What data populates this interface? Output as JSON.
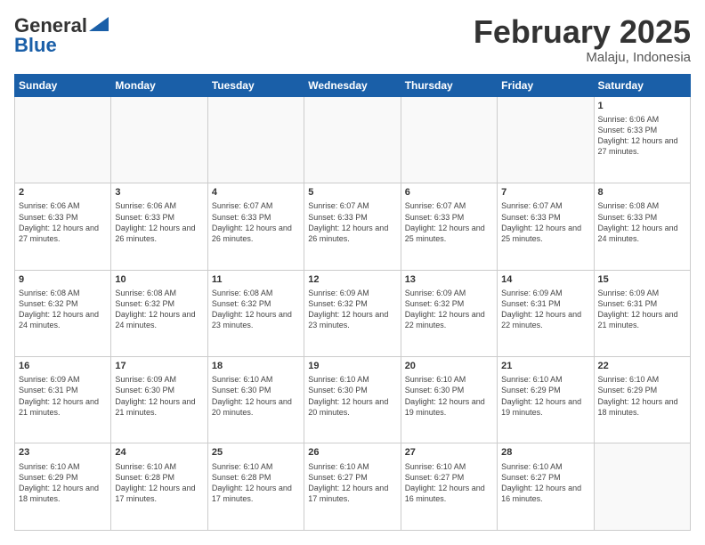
{
  "logo": {
    "line1": "General",
    "line2": "Blue"
  },
  "title": "February 2025",
  "location": "Malaju, Indonesia",
  "days_of_week": [
    "Sunday",
    "Monday",
    "Tuesday",
    "Wednesday",
    "Thursday",
    "Friday",
    "Saturday"
  ],
  "weeks": [
    [
      {
        "day": "",
        "info": ""
      },
      {
        "day": "",
        "info": ""
      },
      {
        "day": "",
        "info": ""
      },
      {
        "day": "",
        "info": ""
      },
      {
        "day": "",
        "info": ""
      },
      {
        "day": "",
        "info": ""
      },
      {
        "day": "1",
        "info": "Sunrise: 6:06 AM\nSunset: 6:33 PM\nDaylight: 12 hours and 27 minutes."
      }
    ],
    [
      {
        "day": "2",
        "info": "Sunrise: 6:06 AM\nSunset: 6:33 PM\nDaylight: 12 hours and 27 minutes."
      },
      {
        "day": "3",
        "info": "Sunrise: 6:06 AM\nSunset: 6:33 PM\nDaylight: 12 hours and 26 minutes."
      },
      {
        "day": "4",
        "info": "Sunrise: 6:07 AM\nSunset: 6:33 PM\nDaylight: 12 hours and 26 minutes."
      },
      {
        "day": "5",
        "info": "Sunrise: 6:07 AM\nSunset: 6:33 PM\nDaylight: 12 hours and 26 minutes."
      },
      {
        "day": "6",
        "info": "Sunrise: 6:07 AM\nSunset: 6:33 PM\nDaylight: 12 hours and 25 minutes."
      },
      {
        "day": "7",
        "info": "Sunrise: 6:07 AM\nSunset: 6:33 PM\nDaylight: 12 hours and 25 minutes."
      },
      {
        "day": "8",
        "info": "Sunrise: 6:08 AM\nSunset: 6:33 PM\nDaylight: 12 hours and 24 minutes."
      }
    ],
    [
      {
        "day": "9",
        "info": "Sunrise: 6:08 AM\nSunset: 6:32 PM\nDaylight: 12 hours and 24 minutes."
      },
      {
        "day": "10",
        "info": "Sunrise: 6:08 AM\nSunset: 6:32 PM\nDaylight: 12 hours and 24 minutes."
      },
      {
        "day": "11",
        "info": "Sunrise: 6:08 AM\nSunset: 6:32 PM\nDaylight: 12 hours and 23 minutes."
      },
      {
        "day": "12",
        "info": "Sunrise: 6:09 AM\nSunset: 6:32 PM\nDaylight: 12 hours and 23 minutes."
      },
      {
        "day": "13",
        "info": "Sunrise: 6:09 AM\nSunset: 6:32 PM\nDaylight: 12 hours and 22 minutes."
      },
      {
        "day": "14",
        "info": "Sunrise: 6:09 AM\nSunset: 6:31 PM\nDaylight: 12 hours and 22 minutes."
      },
      {
        "day": "15",
        "info": "Sunrise: 6:09 AM\nSunset: 6:31 PM\nDaylight: 12 hours and 21 minutes."
      }
    ],
    [
      {
        "day": "16",
        "info": "Sunrise: 6:09 AM\nSunset: 6:31 PM\nDaylight: 12 hours and 21 minutes."
      },
      {
        "day": "17",
        "info": "Sunrise: 6:09 AM\nSunset: 6:30 PM\nDaylight: 12 hours and 21 minutes."
      },
      {
        "day": "18",
        "info": "Sunrise: 6:10 AM\nSunset: 6:30 PM\nDaylight: 12 hours and 20 minutes."
      },
      {
        "day": "19",
        "info": "Sunrise: 6:10 AM\nSunset: 6:30 PM\nDaylight: 12 hours and 20 minutes."
      },
      {
        "day": "20",
        "info": "Sunrise: 6:10 AM\nSunset: 6:30 PM\nDaylight: 12 hours and 19 minutes."
      },
      {
        "day": "21",
        "info": "Sunrise: 6:10 AM\nSunset: 6:29 PM\nDaylight: 12 hours and 19 minutes."
      },
      {
        "day": "22",
        "info": "Sunrise: 6:10 AM\nSunset: 6:29 PM\nDaylight: 12 hours and 18 minutes."
      }
    ],
    [
      {
        "day": "23",
        "info": "Sunrise: 6:10 AM\nSunset: 6:29 PM\nDaylight: 12 hours and 18 minutes."
      },
      {
        "day": "24",
        "info": "Sunrise: 6:10 AM\nSunset: 6:28 PM\nDaylight: 12 hours and 17 minutes."
      },
      {
        "day": "25",
        "info": "Sunrise: 6:10 AM\nSunset: 6:28 PM\nDaylight: 12 hours and 17 minutes."
      },
      {
        "day": "26",
        "info": "Sunrise: 6:10 AM\nSunset: 6:27 PM\nDaylight: 12 hours and 17 minutes."
      },
      {
        "day": "27",
        "info": "Sunrise: 6:10 AM\nSunset: 6:27 PM\nDaylight: 12 hours and 16 minutes."
      },
      {
        "day": "28",
        "info": "Sunrise: 6:10 AM\nSunset: 6:27 PM\nDaylight: 12 hours and 16 minutes."
      },
      {
        "day": "",
        "info": ""
      }
    ]
  ]
}
